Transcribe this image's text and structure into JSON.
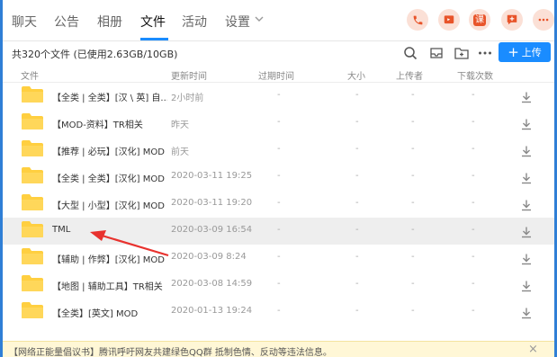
{
  "tabs": [
    {
      "label": "聊天"
    },
    {
      "label": "公告"
    },
    {
      "label": "相册"
    },
    {
      "label": "文件",
      "active": true
    },
    {
      "label": "活动"
    },
    {
      "label": "设置"
    }
  ],
  "action_buttons": [
    {
      "icon": "phone-icon"
    },
    {
      "icon": "video-call-icon"
    },
    {
      "icon": "course-icon",
      "text": "课"
    },
    {
      "icon": "add-app-icon"
    },
    {
      "icon": "more-icon"
    }
  ],
  "toolbar": {
    "count_text": "共320个文件 (已使用2.63GB/10GB)",
    "upload_label": "上传"
  },
  "headers": {
    "file": "文件",
    "updated": "更新时间",
    "expiry": "过期时间",
    "size": "大小",
    "uploader": "上传者",
    "downloads": "下载次数"
  },
  "files": [
    {
      "name": "【全类 | 全类】[汉 \\ 英] 自...",
      "updated": "2小时前",
      "expiry": "-",
      "size": "-",
      "uploader": "-",
      "downloads": "-"
    },
    {
      "name": "【MOD-资料】TR相关",
      "updated": "昨天",
      "expiry": "-",
      "size": "-",
      "uploader": "-",
      "downloads": "-"
    },
    {
      "name": "【推荐 | 必玩】[汉化] MOD",
      "updated": "前天",
      "expiry": "-",
      "size": "-",
      "uploader": "-",
      "downloads": "-"
    },
    {
      "name": "【全类 | 全类】[汉化] MOD",
      "updated": "2020-03-11 19:25",
      "expiry": "-",
      "size": "-",
      "uploader": "-",
      "downloads": "-"
    },
    {
      "name": "【大型 | 小型】[汉化] MOD",
      "updated": "2020-03-11 19:20",
      "expiry": "-",
      "size": "-",
      "uploader": "-",
      "downloads": "-"
    },
    {
      "name": "TML",
      "updated": "2020-03-09 16:54",
      "expiry": "-",
      "size": "-",
      "uploader": "-",
      "downloads": "-",
      "selected": true
    },
    {
      "name": "【辅助 | 作弊】[汉化] MOD",
      "updated": "2020-03-09 8:24",
      "expiry": "-",
      "size": "-",
      "uploader": "-",
      "downloads": "-"
    },
    {
      "name": "【地图 | 辅助工具】TR相关",
      "updated": "2020-03-08 14:59",
      "expiry": "-",
      "size": "-",
      "uploader": "-",
      "downloads": "-"
    },
    {
      "name": "【全类】[英文] MOD",
      "updated": "2020-01-13 19:24",
      "expiry": "-",
      "size": "-",
      "uploader": "-",
      "downloads": "-"
    }
  ],
  "notice": {
    "text": "【网络正能量倡议书】腾讯呼吁网友共建绿色QQ群 抵制色情、反动等违法信息。",
    "close": "×"
  },
  "colors": {
    "accent": "#1a8cff",
    "folder": "#ffcf40",
    "annotation_arrow": "#e8322e",
    "action_icon": "#e8542a"
  }
}
